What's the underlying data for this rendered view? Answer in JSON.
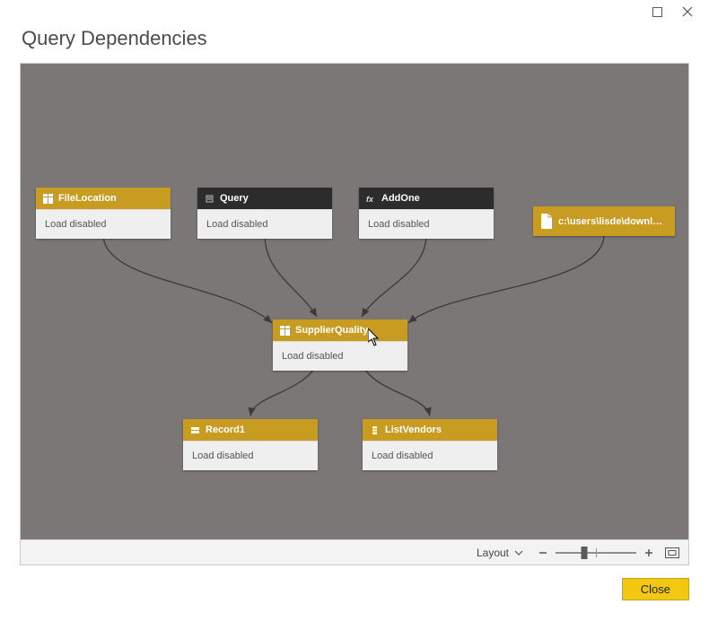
{
  "window": {
    "title": "Query Dependencies"
  },
  "nodes": {
    "fileLocation": {
      "label": "FileLocation",
      "status": "Load disabled"
    },
    "query": {
      "label": "Query",
      "status": "Load disabled"
    },
    "addOne": {
      "label": "AddOne",
      "status": "Load disabled"
    },
    "fileSource": {
      "label": "c:\\users\\lisde\\downloads..."
    },
    "supplierQuality": {
      "label": "SupplierQuality",
      "status": "Load disabled"
    },
    "record1": {
      "label": "Record1",
      "status": "Load disabled"
    },
    "listVendors": {
      "label": "ListVendors",
      "status": "Load disabled"
    }
  },
  "toolbar": {
    "layout_label": "Layout",
    "zoom": {
      "min": 0,
      "max": 100,
      "value": 35
    }
  },
  "footer": {
    "close_label": "Close"
  }
}
